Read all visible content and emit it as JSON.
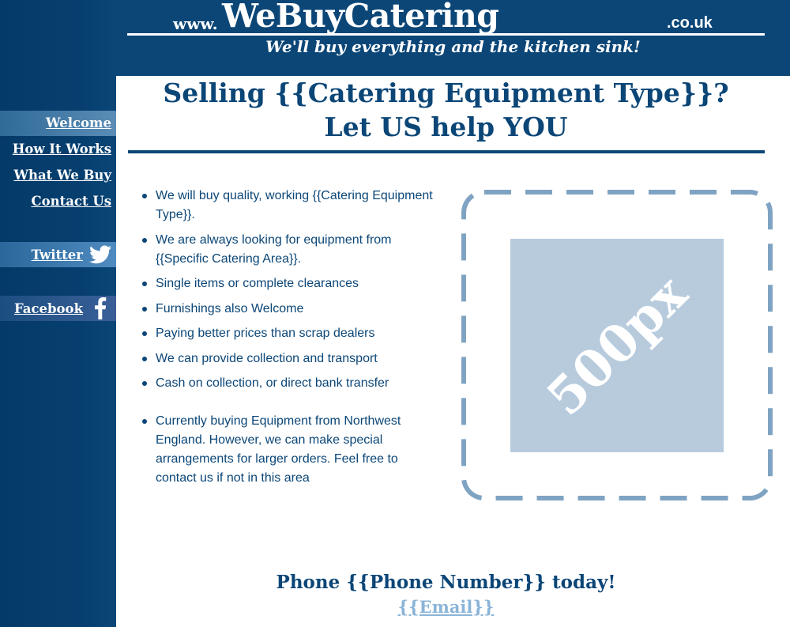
{
  "header": {
    "logo_prefix": "www.",
    "logo_brand": "WeBuyCatering",
    "logo_suffix": ".co.uk",
    "tagline": "We'll buy everything and the kitchen sink!"
  },
  "sidebar": {
    "nav": [
      {
        "label": "Welcome",
        "active": true
      },
      {
        "label": "How It Works",
        "active": false
      },
      {
        "label": "What We Buy",
        "active": false
      },
      {
        "label": "Contact Us",
        "active": false
      }
    ],
    "social": [
      {
        "label": "Twitter",
        "icon": "twitter-bird-icon"
      },
      {
        "label": "Facebook",
        "icon": "facebook-f-icon"
      }
    ]
  },
  "main": {
    "headline_line1": "Selling {{Catering Equipment Type}}?",
    "headline_line2": "Let US help YOU",
    "features": [
      "We will buy quality, working {{Catering Equipment Type}}.",
      "We are always looking for equipment from {{Specific Catering Area}}.",
      "Single items or complete clearances",
      "Furnishings also Welcome",
      "Paying better prices than scrap dealers",
      "We can provide collection and transport",
      "Cash on collection, or direct bank transfer",
      "Currently buying Equipment from Northwest England. However, we can make special arrangements for larger orders. Feel free to contact us if not in this area"
    ],
    "image_placeholder": "500px",
    "cta": "Phone {{Phone Number}} today!",
    "email": "{{Email}}"
  },
  "colors": {
    "brand_navy": "#0b4677",
    "sidebar_navy": "#043a68",
    "active_nav": "#3a74a1",
    "placeholder_fill": "#b7cbdd",
    "dashed_border": "#7fa3c2",
    "email_link": "#8ab4d8"
  }
}
